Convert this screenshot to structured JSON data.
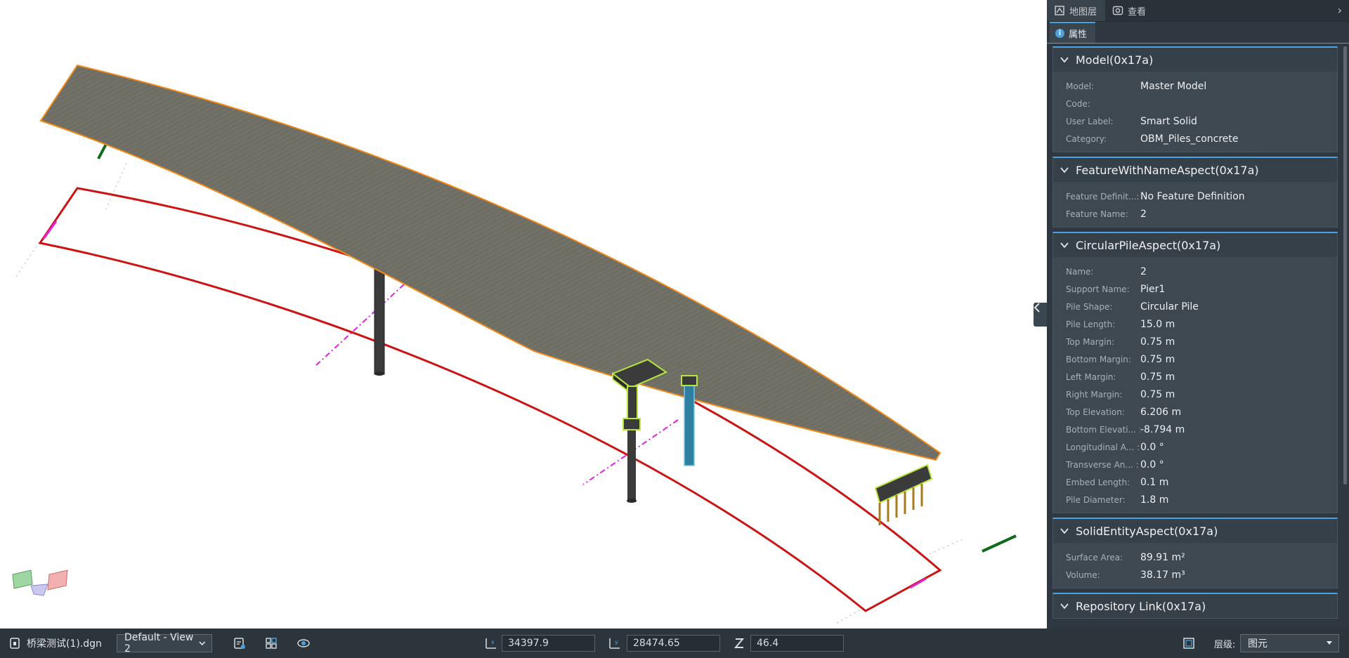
{
  "viewport": {
    "colors": {
      "deck": "#6e6e64",
      "deck_edge": "#f08a1c",
      "outline": "#cc1414",
      "axis_green": "#0f6b1a",
      "guide_magenta": "#e020e0",
      "pile_cyan": "#2f7fa0",
      "bracket_green": "#b7e640"
    }
  },
  "panel": {
    "tabs": [
      {
        "label": "地图层",
        "icon": "layers-icon"
      },
      {
        "label": "查看",
        "icon": "view-icon"
      }
    ],
    "subtab": {
      "label": "属性",
      "icon": "info-icon"
    },
    "sections": [
      {
        "title": "Model(0x17a)",
        "rows": [
          {
            "key": "Model:",
            "value": "Master Model"
          },
          {
            "key": "Code:",
            "value": ""
          },
          {
            "key": "User Label:",
            "value": "Smart Solid"
          },
          {
            "key": "Category:",
            "value": "OBM_Piles_concrete"
          }
        ]
      },
      {
        "title": "FeatureWithNameAspect(0x17a)",
        "rows": [
          {
            "key": "Feature Definit...:",
            "value": "No Feature Definition"
          },
          {
            "key": "Feature Name:",
            "value": "2"
          }
        ]
      },
      {
        "title": "CircularPileAspect(0x17a)",
        "rows": [
          {
            "key": "Name:",
            "value": "2"
          },
          {
            "key": "Support Name:",
            "value": "Pier1"
          },
          {
            "key": "Pile Shape:",
            "value": "Circular Pile"
          },
          {
            "key": "Pile Length:",
            "value": "15.0 m"
          },
          {
            "key": "Top Margin:",
            "value": "0.75 m"
          },
          {
            "key": "Bottom Margin:",
            "value": "0.75 m"
          },
          {
            "key": "Left Margin:",
            "value": "0.75 m"
          },
          {
            "key": "Right Margin:",
            "value": "0.75 m"
          },
          {
            "key": "Top Elevation:",
            "value": "6.206 m"
          },
          {
            "key": "Bottom Elevati... :",
            "value": "-8.794 m"
          },
          {
            "key": "Longitudinal A... :",
            "value": "0.0 °"
          },
          {
            "key": "Transverse An... :",
            "value": "0.0 °"
          },
          {
            "key": "Embed Length:",
            "value": "0.1 m"
          },
          {
            "key": "Pile Diameter:",
            "value": "1.8 m"
          }
        ]
      },
      {
        "title": "SolidEntityAspect(0x17a)",
        "rows": [
          {
            "key": "Surface Area:",
            "value": "89.91 m²"
          },
          {
            "key": "Volume:",
            "value": "38.17 m³"
          }
        ]
      },
      {
        "title": "Repository Link(0x17a)",
        "rows": []
      }
    ]
  },
  "statusbar": {
    "file_name": "桥梁测试(1).dgn",
    "view_select": "Default - View 2",
    "coord_x": "34397.9",
    "coord_y": "28474.65",
    "coord_z": "46.4",
    "level_label": "层级:",
    "level_value": "图元"
  }
}
